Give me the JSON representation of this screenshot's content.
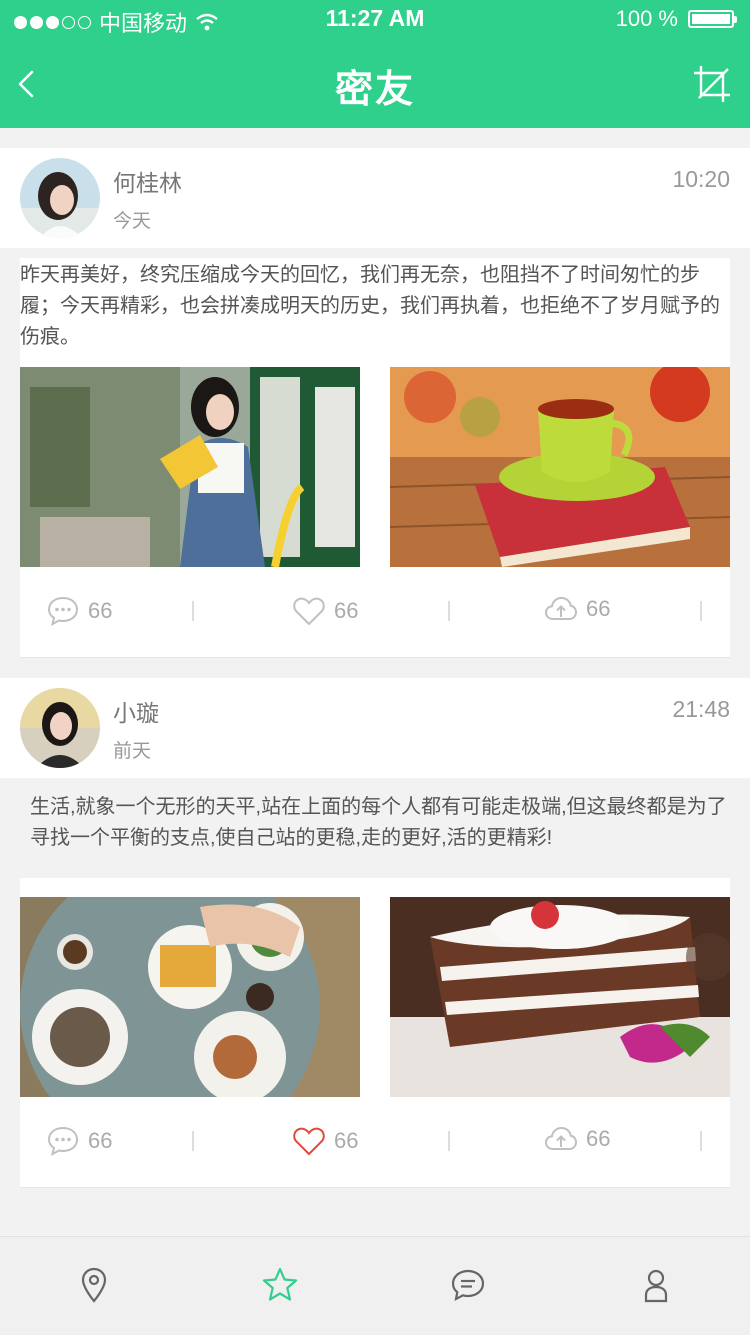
{
  "status_bar": {
    "carrier": "中国移动",
    "time": "11:27 AM",
    "battery": "100 %",
    "signal_bars_filled": 3,
    "signal_bars_total": 5
  },
  "nav": {
    "title": "密友",
    "back_icon": "chevron-left-icon",
    "edit_icon": "crop-edit-icon"
  },
  "posts": [
    {
      "name": "何桂林",
      "date": "今天",
      "time": "10:20",
      "text": "昨天再美好，终究压缩成今天的回忆，我们再无奈，也阻挡不了时间匆忙的步履；今天再精彩，也会拼凑成明天的历史，我们再执着，也拒绝不了岁月赋予的伤痕。",
      "images": [
        "girl-reading-book-photo",
        "tea-cup-on-book-photo"
      ],
      "comments": "66",
      "likes": "66",
      "liked": false,
      "shares": "66"
    },
    {
      "name": "小璇",
      "date": "前天",
      "time": "21:48",
      "text": "生活,就象一个无形的天平,站在上面的每个人都有可能走极端,但这最终都是为了寻找一个平衡的支点,使自己站的更稳,走的更好,活的更精彩!",
      "images": [
        "breakfast-table-photo",
        "chocolate-cake-photo"
      ],
      "comments": "66",
      "likes": "66",
      "liked": true,
      "shares": "66"
    }
  ],
  "tabbar": {
    "items": [
      "location-pin-icon",
      "star-icon",
      "chat-bubble-icon",
      "person-icon"
    ],
    "active": "star-icon"
  },
  "colors": {
    "brand": "#2fcf8c",
    "like_active": "#e04a3a",
    "icon_gray": "#bbbbbb",
    "tab_active": "#2fcf8c"
  }
}
